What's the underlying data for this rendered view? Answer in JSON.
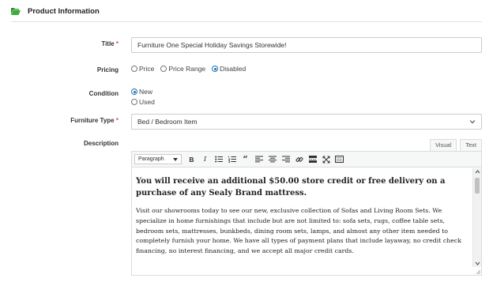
{
  "section": {
    "title": "Product Information",
    "icon": "folder-open-icon"
  },
  "title_field": {
    "label": "Title",
    "required_mark": "*",
    "value": "Furniture One Special Holiday Savings Storewide!"
  },
  "pricing": {
    "label": "Pricing",
    "options": [
      {
        "label": "Price",
        "checked": false
      },
      {
        "label": "Price Range",
        "checked": false
      },
      {
        "label": "Disabled",
        "checked": true
      }
    ]
  },
  "condition": {
    "label": "Condition",
    "options": [
      {
        "label": "New",
        "checked": true
      },
      {
        "label": "Used",
        "checked": false
      }
    ]
  },
  "furniture_type": {
    "label": "Furniture Type",
    "required_mark": "*",
    "value": "Bed / Bedroom Item"
  },
  "description": {
    "label": "Description",
    "tabs": {
      "visual": "Visual",
      "text": "Text"
    },
    "format": "Paragraph",
    "heading": "You will receive an additional $50.00 store credit or free delivery on a purchase of any Sealy Brand mattress.",
    "paragraph": "Visit our showrooms today to see our new, exclusive collection of Sofas and Living Room Sets. We specialize in home furnishings that include but are not limited to: sofa sets, rugs, coffee table sets, bedroom sets, mattresses, bunkbeds, dining room sets, lamps, and almost any other item needed to completely furnish your home. We have all types of payment plans that include layaway, no credit check financing, no interest financing, and we accept all major credit cards."
  },
  "colors": {
    "accent": "#2271b1",
    "required": "#d9534f",
    "folder": "#3c9a3c"
  }
}
